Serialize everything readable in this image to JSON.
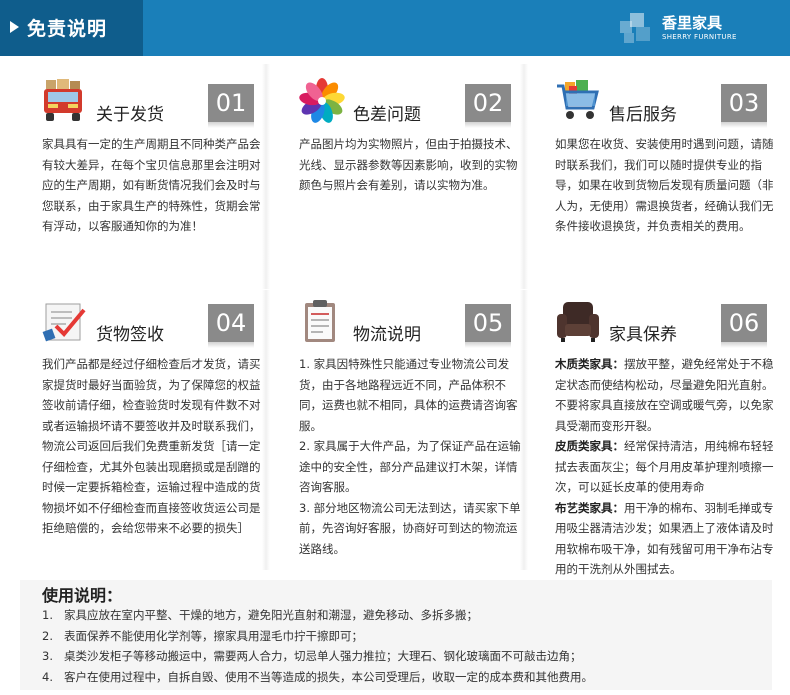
{
  "header": {
    "title": "免责说明",
    "logo_cn": "香里家具",
    "logo_en": "SHERRY FURNITURE"
  },
  "cards": [
    {
      "title": "关于发货",
      "number": "01",
      "icon": "delivery-truck-icon",
      "paragraphs": [
        "家具具有一定的生产周期且不同种类产品会有较大差异，在每个宝贝信息那里会注明对应的生产周期，如有断货情况我们会及时与您联系，由于家具生产的特殊性，货期会常有浮动，以客服通知你的为准！"
      ]
    },
    {
      "title": "色差问题",
      "number": "02",
      "icon": "color-wheel-icon",
      "paragraphs": [
        "产品图片均为实物照片，但由于拍摄技术、光线、显示器参数等因素影响，收到的实物颜色与照片会有差别，请以实物为准。"
      ]
    },
    {
      "title": "售后服务",
      "number": "03",
      "icon": "shopping-cart-icon",
      "paragraphs": [
        "如果您在收货、安装使用时遇到问题，请随时联系我们，我们可以随时提供专业的指导，如果在收到货物后发现有质量问题（非人为，无使用）需退换货者，经确认我们无条件接收退换货，并负责相关的费用。"
      ]
    },
    {
      "title": "货物签收",
      "number": "04",
      "icon": "sign-checkmark-icon",
      "paragraphs": [
        "我们产品都是经过仔细检查后才发货，请买家提货时最好当面验货，为了保障您的权益签收前请仔细，检查验货时发现有件数不对或者运输损坏请不要签收并及时联系我们，物流公司返回后我们免费重新发货［请一定仔细检查，尤其外包装出现磨损或是刮蹭的时候一定要拆箱检查，运输过程中造成的货物损坏如不仔细检查而直接签收货运公司是拒绝赔偿的，会给您带来不必要的损失］"
      ]
    },
    {
      "title": "物流说明",
      "number": "05",
      "icon": "clipboard-icon",
      "paragraphs": [
        "1. 家具因特殊性只能通过专业物流公司发货，由于各地路程远近不同，产品体积不同，运费也就不相同，具体的运费请咨询客服。",
        "2. 家具属于大件产品，为了保证产品在运输途中的安全性，部分产品建议打木架，详情咨询客服。",
        "3. 部分地区物流公司无法到达，请买家下单前，先咨询好客服，协商好可到达的物流运送路线。"
      ]
    },
    {
      "title": "家具保养",
      "number": "06",
      "icon": "armchair-icon",
      "sections": [
        {
          "label": "木质类家具：",
          "text": "摆放平整，避免经常处于不稳定状态而使结构松动，尽量避免阳光直射。不要将家具直接放在空调或暖气旁，以免家具受潮而变形开裂。"
        },
        {
          "label": "皮质类家具：",
          "text": "经常保持清洁，用纯棉布轻轻拭去表面灰尘；每个月用皮革护理剂喷擦一次，可以延长皮革的使用寿命"
        },
        {
          "label": "布艺类家具：",
          "text": "用干净的棉布、羽制毛掸或专用吸尘器清洁沙发；如果洒上了液体请及时用软棉布吸干净，如有残留可用干净布沾专用的干洗剂从外围拭去。"
        }
      ]
    }
  ],
  "usage": {
    "title": "使用说明：",
    "items": [
      {
        "n": "1.",
        "text": "家具应放在室内平整、干燥的地方，避免阳光直射和潮湿，避免移动、多拆多搬；"
      },
      {
        "n": "2.",
        "text": "表面保养不能使用化学剂等，擦家具用湿毛巾拧干擦即可；"
      },
      {
        "n": "3.",
        "text": "桌类沙发柜子等移动搬运中，需要两人合力，切忌单人强力推拉；大理石、钢化玻璃面不可敲击边角；"
      },
      {
        "n": "4.",
        "text": "客户在使用过程中，自拆自毁、使用不当等造成的损失，本公司受理后，收取一定的成本费和其他费用。"
      }
    ]
  },
  "colors": {
    "header_bg": "#1a7fb9",
    "header_tab": "#0f5d8c",
    "number_badge": "#8a8a8a"
  }
}
